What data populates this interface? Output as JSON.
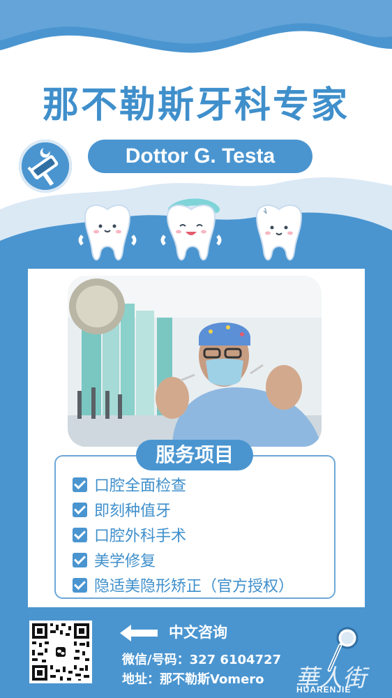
{
  "header": {
    "title": "那不勒斯牙科专家",
    "doctor_name": "Dottor G. Testa"
  },
  "services": {
    "heading": "服务项目",
    "items": [
      "口腔全面检查",
      "即刻种值牙",
      "口腔外科手术",
      "美学修复",
      "隐适美隐形矫正（官方授权）"
    ]
  },
  "contact": {
    "consult_label": "中文咨询",
    "wechat_line": "微信/号码：327 6104727",
    "address_line": "地址：那不勒斯Vomero"
  },
  "watermark": {
    "text_cn": "華人街",
    "text_en": "HUARENJIE"
  },
  "colors": {
    "accent": "#4a95d0",
    "light_wave": "#dbe9f5",
    "title": "#3f8fcb"
  },
  "icons": [
    "dental-logo-icon",
    "tooth-icon",
    "check-icon",
    "arrow-left-icon",
    "qr-code",
    "dental-mirror-icon"
  ]
}
